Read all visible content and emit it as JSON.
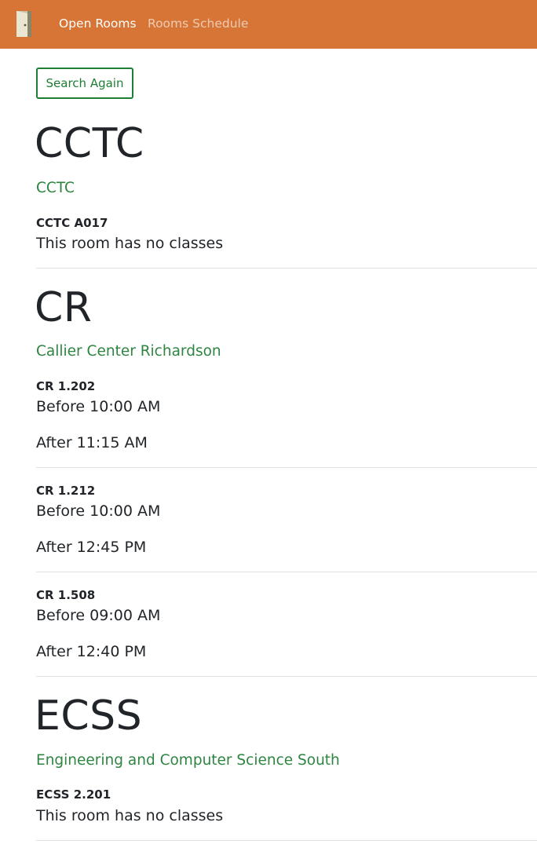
{
  "nav": {
    "logo_icon": "door-icon",
    "links": [
      "Open Rooms",
      "Rooms Schedule"
    ]
  },
  "search_again_label": "Search Again",
  "buildings": [
    {
      "code": "CCTC",
      "name": "CCTC",
      "rooms": [
        {
          "id": "CCTC A017",
          "lines": [
            "This room has no classes"
          ]
        }
      ]
    },
    {
      "code": "CR",
      "name": "Callier Center Richardson",
      "rooms": [
        {
          "id": "CR 1.202",
          "lines": [
            "Before 10:00 AM",
            "After 11:15 AM"
          ]
        },
        {
          "id": "CR 1.212",
          "lines": [
            "Before 10:00 AM",
            "After 12:45 PM"
          ]
        },
        {
          "id": "CR 1.508",
          "lines": [
            "Before 09:00 AM",
            "After 12:40 PM"
          ]
        }
      ]
    },
    {
      "code": "ECSS",
      "name": "Engineering and Computer Science South",
      "rooms": [
        {
          "id": "ECSS 2.201",
          "lines": [
            "This room has no classes"
          ]
        }
      ]
    }
  ],
  "colors": {
    "navbar": "#d67536",
    "accent_green": "#2e8540",
    "text": "#212529",
    "divider": "#dee2e6"
  }
}
